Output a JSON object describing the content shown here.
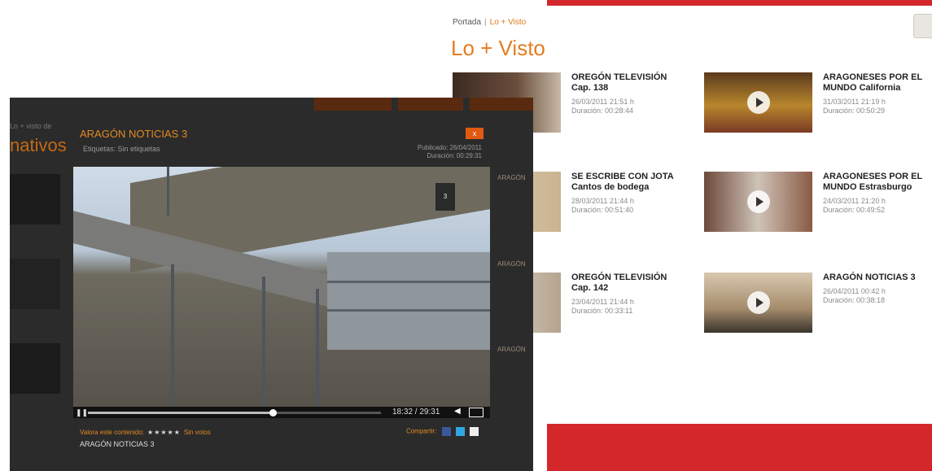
{
  "site": {
    "faded_logo": "",
    "breadcrumb": {
      "home": "Portada",
      "separator": "|",
      "current": "Lo + Visto"
    },
    "page_title": "Lo + Visto",
    "accent": "#e57c22",
    "brand_red": "#d4272c"
  },
  "cards": [
    {
      "title": "OREGÓN TELEVISIÓN Cap. 138",
      "date": "26/03/2011 21:51 h",
      "duration": "Duración: 00:28:44",
      "icon": "video-thumbnail"
    },
    {
      "title": "ARAGONESES POR EL MUNDO California",
      "date": "31/03/2011 21:19 h",
      "duration": "Duración: 00:50:29",
      "icon": "play-icon"
    },
    {
      "title": "SE ESCRIBE CON JOTA Cantos de bodega",
      "date": "28/03/2011 21:44 h",
      "duration": "Duración: 00:51:40",
      "icon": "video-thumbnail"
    },
    {
      "title": "ARAGONESES POR EL MUNDO Estrasburgo",
      "date": "24/03/2011 21:20 h",
      "duration": "Duración: 00:49:52",
      "icon": "play-icon"
    },
    {
      "title": "OREGÓN TELEVISIÓN Cap. 142",
      "date": "23/04/2011 21:44 h",
      "duration": "Duración: 00:33:11",
      "icon": "video-thumbnail"
    },
    {
      "title": "ARAGÓN NOTICIAS 3",
      "date": "26/04/2011 00:42 h",
      "duration": "Duración: 00:38:18",
      "icon": "play-icon"
    }
  ],
  "side_strips": [
    "ARAGÓN",
    "ARAGÓN",
    "ARAGÓN"
  ],
  "overlay": {
    "left_section_label": "Lo + visto de",
    "left_big": "nativos",
    "modal": {
      "title": "ARAGÓN NOTICIAS 3",
      "tags": "Etiquetas: Sin etiquetas",
      "published": "Publicado: 26/04/2011",
      "duration": "Duración: 00:29:31",
      "close_label": "x",
      "badge": "3",
      "player": {
        "time": "18:32 / 29:31",
        "progress": 0.63
      },
      "rate_label": "Valora este contenido:",
      "stars": "★★★★★",
      "votes": "Sin votos",
      "caption": "ARAGÓN NOTICIAS 3",
      "share_label": "Compartir:"
    }
  }
}
